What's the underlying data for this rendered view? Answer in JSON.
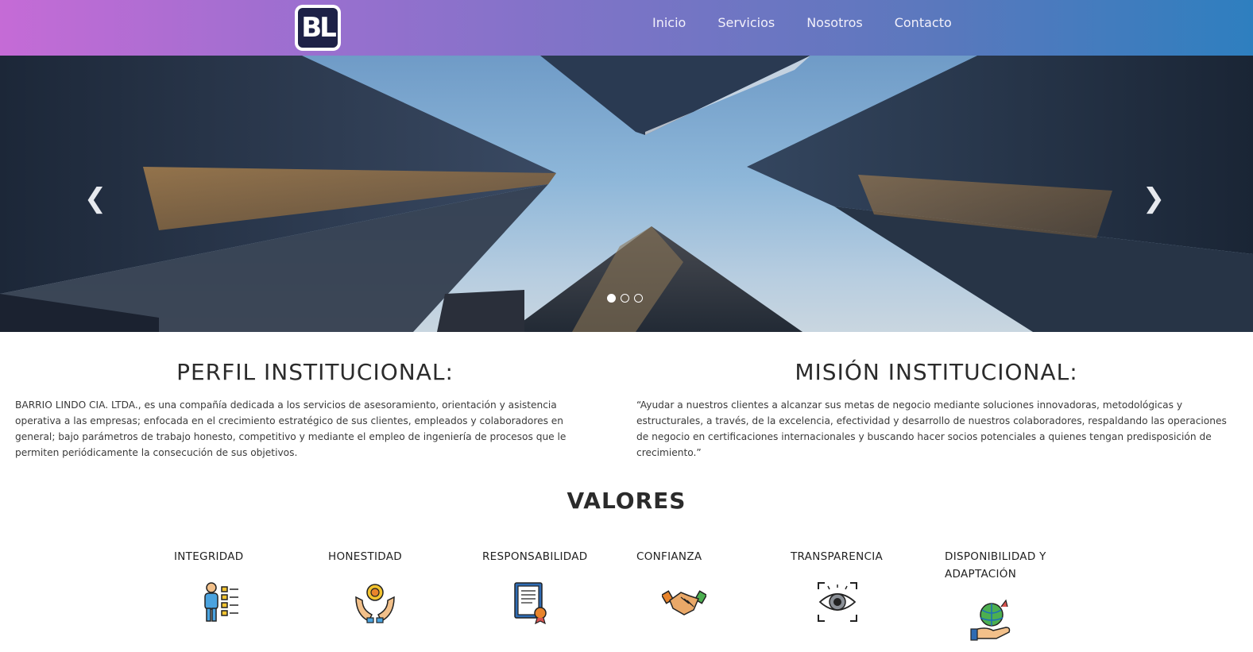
{
  "navbar": {
    "logo_text": "BL",
    "links": [
      "Inicio",
      "Servicios",
      "Nosotros",
      "Contacto"
    ]
  },
  "carousel": {
    "prev_icon": "chevron-left-icon",
    "next_icon": "chevron-right-icon",
    "prev_glyph": "❮",
    "next_glyph": "❯",
    "slide_count": 3,
    "active_slide": 1
  },
  "perfil": {
    "title": "PERFIL INSTITUCIONAL:",
    "text": "BARRIO LINDO CIA. LTDA., es una compañía dedicada a los servicios de asesoramiento, orientación y asistencia operativa a las empresas; enfocada en el crecimiento estratégico de sus clientes, empleados y colaboradores en general; bajo parámetros de trabajo honesto, competitivo y mediante el empleo de ingeniería de procesos que le permiten periódicamente la consecución de sus objetivos."
  },
  "mision": {
    "title": "MISIÓN INSTITUCIONAL:",
    "text": "“Ayudar a nuestros clientes a alcanzar sus metas de negocio mediante soluciones innovadoras, metodológicas y estructurales, a través, de la excelencia, efectividad y desarrollo de nuestros colaboradores, respaldando las operaciones de negocio en certificaciones internacionales y buscando hacer socios potenciales a quienes tengan predisposición de crecimiento.”"
  },
  "valores": {
    "title": "VALORES",
    "items": [
      {
        "label": "INTEGRIDAD",
        "icon": "checklist-person-icon"
      },
      {
        "label": "HONESTIDAD",
        "icon": "hands-medal-icon"
      },
      {
        "label": "RESPONSABILIDAD",
        "icon": "certificate-icon"
      },
      {
        "label": "CONFIANZA",
        "icon": "handshake-icon"
      },
      {
        "label": "TRANSPARENCIA",
        "icon": "eye-scan-icon"
      },
      {
        "label": "DISPONIBILIDAD Y ADAPTACIÓN",
        "icon": "hand-globe-icon"
      }
    ]
  },
  "colors": {
    "nav_gradient_start": "#c56bd6",
    "nav_gradient_end": "#2e7fbf",
    "logo_bg": "#1d2147"
  }
}
